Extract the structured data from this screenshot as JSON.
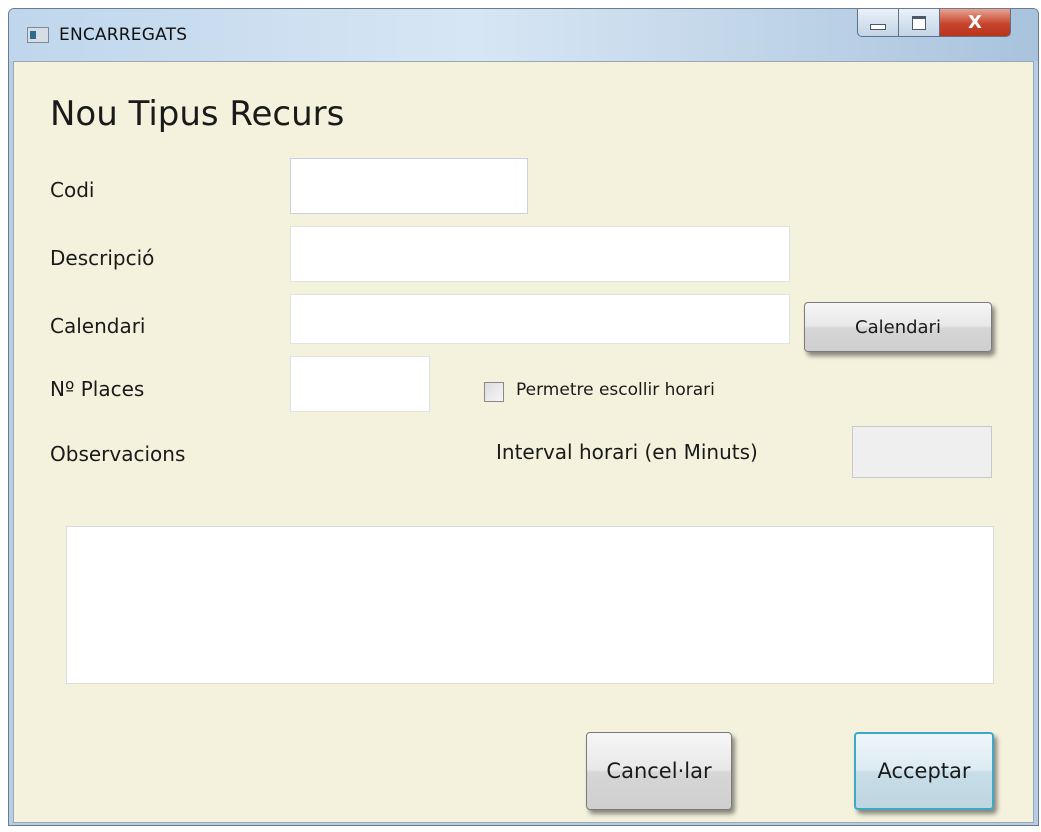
{
  "window": {
    "title": "ENCARREGATS",
    "close_glyph": "X",
    "icons": {
      "app": "app-window-icon",
      "minimize": "minimize-icon",
      "maximize": "maximize-icon",
      "close": "close-icon"
    }
  },
  "form": {
    "title": "Nou Tipus Recurs",
    "fields": {
      "codi": {
        "label": "Codi",
        "value": ""
      },
      "descripcio": {
        "label": "Descripció",
        "value": ""
      },
      "calendari": {
        "label": "Calendari",
        "value": ""
      },
      "places": {
        "label": "Nº Places",
        "value": ""
      },
      "interval": {
        "label": "Interval horari (en Minuts)",
        "value": ""
      },
      "observacions": {
        "label": "Observacions",
        "value": ""
      }
    },
    "checkbox": {
      "label": "Permetre escollir horari",
      "checked": false
    },
    "buttons": {
      "calendari": "Calendari",
      "cancel": "Cancel·lar",
      "accept": "Acceptar"
    }
  },
  "colors": {
    "client_background": "#f4f2dd",
    "accept_border": "#3fa7c8",
    "close_button": "#c8452d"
  }
}
